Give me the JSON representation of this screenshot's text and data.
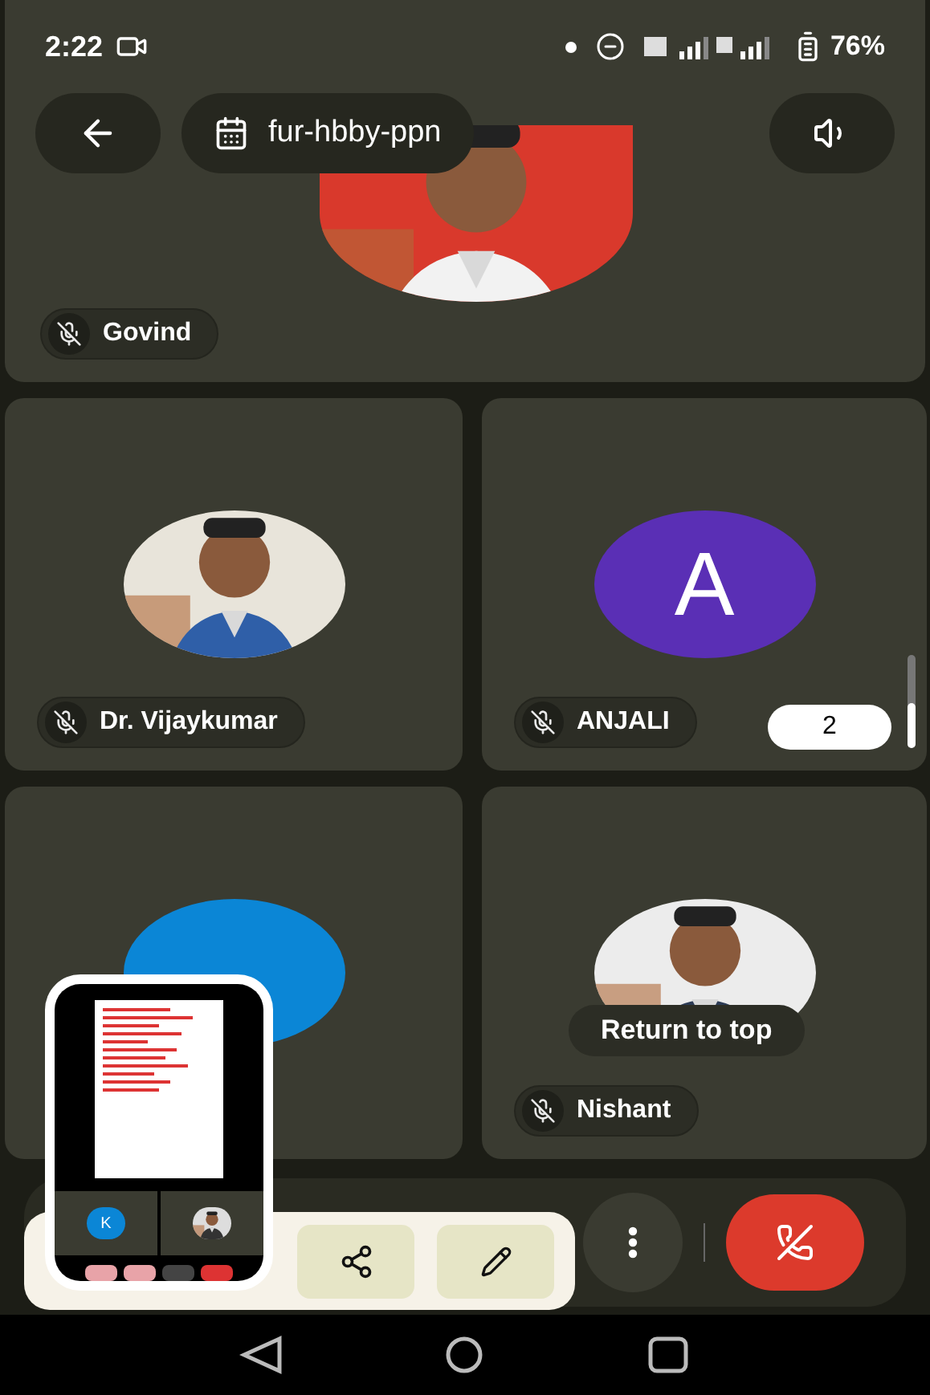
{
  "status_bar": {
    "time": "2:22",
    "battery": "76%"
  },
  "meeting": {
    "code": "fur-hbby-ppn"
  },
  "participants": [
    {
      "name": "Govind",
      "muted": true
    },
    {
      "name": "Dr. Vijaykumar",
      "muted": true
    },
    {
      "kind": "initial",
      "initial": "A",
      "color": "#5a2fb5",
      "name": "ANJALI",
      "muted": true
    },
    {
      "kind": "initial",
      "color": "#0b86d6"
    },
    {
      "name": "Nishant",
      "muted": true
    }
  ],
  "page_badge": "2",
  "return_to_top": "Return to top",
  "preview": {
    "initial": "K"
  }
}
